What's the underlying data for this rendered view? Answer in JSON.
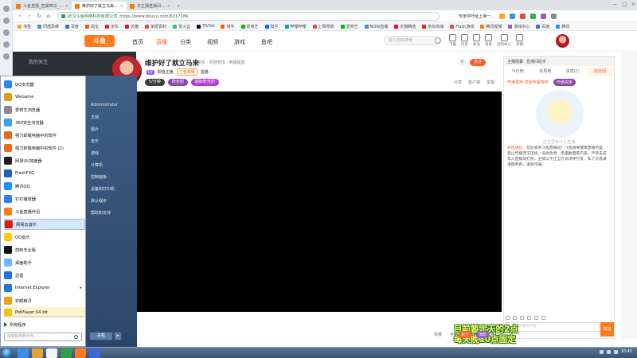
{
  "browser": {
    "tabs": [
      {
        "label": "斗鱼直播_直播带货_..."
      },
      {
        "label": "维护好了就立马来...",
        "active": true
      },
      {
        "label": "非主播直播间..."
      }
    ],
    "url_site": "武汉斗鱼网络科技有限公司",
    "url_path": "https://www.douyu.com/6317186",
    "hint": "专家呼吁给上海一..."
  },
  "bookmarks": [
    "书签",
    "同盾思维",
    "百度",
    "淘宝",
    "京东",
    "天猫",
    "单层百科",
    "爱火云",
    "TikTok",
    "快手",
    "爱奇艺",
    "知乎",
    "哔哩哔哩",
    "上网导航",
    "爱奇艺",
    "NOW直播",
    "天猫精选",
    "京东商城",
    "Flash游戏",
    "腾讯视频",
    "游戏中心",
    "百度",
    "腾讯"
  ],
  "site": {
    "logo": "斗鱼",
    "nav": [
      {
        "label": "首页"
      },
      {
        "label": "直播",
        "active": true
      },
      {
        "label": "分类"
      },
      {
        "label": "视频"
      },
      {
        "label": "游戏"
      },
      {
        "label": "鱼吧"
      }
    ],
    "search_placeholder": "输入您的搜索",
    "header_icons": [
      "下载",
      "历史",
      "关注",
      "消息",
      "创作中心",
      "开播"
    ]
  },
  "page_sidebar_label": "我的关注",
  "room": {
    "title": "维护好了就立马来",
    "category": "单机 · 网游竞技 · 英雄联盟",
    "level": "LV",
    "tags": [
      "颜值主播",
      "王者荣耀",
      "首播"
    ],
    "pills": [
      "5/分钟",
      "粉丝团",
      "超级粉丝团"
    ],
    "follow_count": "0",
    "follow_label": "关注",
    "actions": [
      "分享",
      "客户端",
      "举报"
    ]
  },
  "video_bar_actions": [
    "举报",
    "手机看",
    "分享",
    "链接"
  ],
  "chat": {
    "top_tabs": [
      "主播招募",
      "直播间助手"
    ],
    "rank_tabs": [
      "今日榜",
      "本周榜",
      "贵宾(1)",
      "粉丝团"
    ],
    "noble_text": "开通贵族·享受专属特权",
    "noble_btn": "开通贵族",
    "mascot_caption": "还在思考什么直播",
    "system_tag": "系统通知：",
    "system_msg": "欢迎来到斗鱼直播间！斗鱼倡导健康直播内容，禁止传播违法违规、低俗色情、吸烟酗酒等内容。严禁未成年人直播或打赏，主播以不正当方式诱导打赏、私下交易请谨慎判断，谨防诈骗。",
    "input_placeholder": "这里输入聊天内容",
    "send_label": "发送"
  },
  "overlay": {
    "line1": "目前暂定天的2点",
    "line2": "每天晚10点固定",
    "tag_a": "关注",
    "tag_b": "加粉"
  },
  "start_menu": {
    "items": [
      {
        "label": "QQ浏览器",
        "icon": "#2a8bf2"
      },
      {
        "label": "WeGame",
        "icon": "#d9a21b"
      },
      {
        "label": "爱奇艺浏览器",
        "icon": "#888"
      },
      {
        "label": "360安全浏览器",
        "icon": "#3aa0e8"
      },
      {
        "label": "强力卸载电脑中的软件",
        "icon": "#e86a1a"
      },
      {
        "label": "强力卸载电脑中的软件 (2)",
        "icon": "#e86a1a"
      },
      {
        "label": "网易UU加速器",
        "icon": "#1f1f1f"
      },
      {
        "label": "FlashFXQ",
        "icon": "#2060c0"
      },
      {
        "label": "腾讯QQ",
        "icon": "#1e90ff"
      },
      {
        "label": "钉钉播放器",
        "icon": "#2f7cf6"
      },
      {
        "label": "斗鱼直播伴侣",
        "icon": "#ff7a1a"
      },
      {
        "label": "网易云音乐",
        "icon": "#d81e06",
        "highlight": true
      },
      {
        "label": "QQ音乐",
        "icon": "#f5d300"
      },
      {
        "label": "剪映专业版",
        "icon": "#111"
      },
      {
        "label": "桌面助手",
        "icon": "#6fb4ff"
      },
      {
        "label": "迅雷",
        "icon": "#1e73d8"
      },
      {
        "label": "Internet Explorer",
        "icon": "#1f7bd4",
        "submenu": true
      },
      {
        "label": "护眼精灵",
        "icon": "#f2a20a"
      },
      {
        "label": "PotPlayer 64 bit",
        "icon": "#f1c40f"
      }
    ],
    "all_programs": "所有程序",
    "search_placeholder": "搜索程序和文件",
    "right_items": [
      "Administrator",
      "文档",
      "图片",
      "音乐",
      "游戏",
      "计算机",
      "控制面板",
      "设备和打印机",
      "默认程序",
      "帮助和支持"
    ],
    "shutdown": "关机"
  },
  "taskbar": {
    "apps": [
      "#3a8ee6",
      "#e9a23b",
      "#f5f5f5",
      "#2ea043",
      "#ff7a1a",
      "#3a6ad6"
    ],
    "time": "10:45"
  }
}
